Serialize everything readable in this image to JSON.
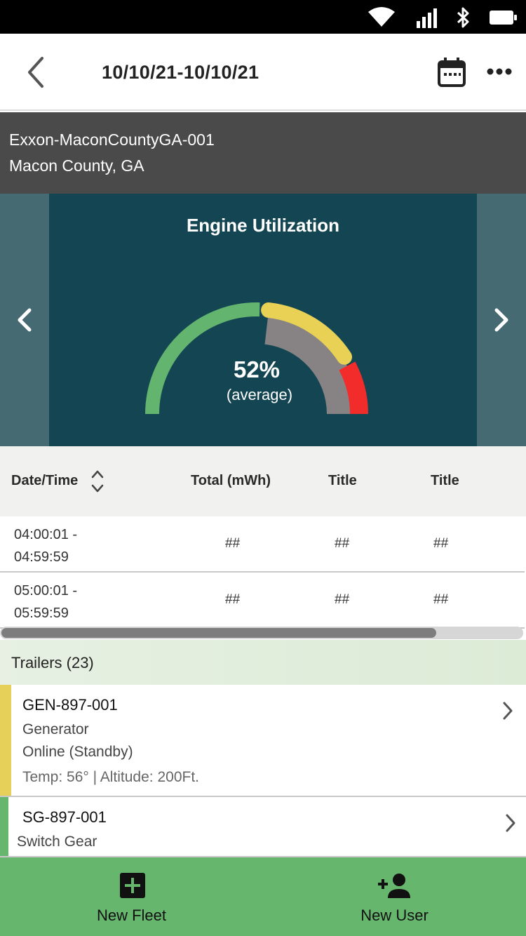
{
  "header": {
    "date_range": "10/10/21-10/10/21"
  },
  "site": {
    "name": "Exxon-MaconCountyGA-001",
    "location": "Macon County, GA"
  },
  "gauge": {
    "title": "Engine Utilization",
    "value_text": "52%",
    "subtitle": "(average)",
    "value_percent": 52,
    "colors": {
      "green": "#63b46f",
      "yellow": "#e8d155",
      "red": "#f22b2b",
      "fill": "#878384"
    }
  },
  "table": {
    "columns": [
      "Date/Time",
      "Total (mWh)",
      "Title",
      "Title"
    ],
    "rows": [
      {
        "time": "04:00:01 - 04:59:59",
        "total": "##",
        "col3": "##",
        "col4": "##"
      },
      {
        "time": "05:00:01 - 05:59:59",
        "total": "##",
        "col3": "##",
        "col4": "##"
      }
    ]
  },
  "trailers": {
    "header": "Trailers (23)",
    "items": [
      {
        "id": "GEN-897-001",
        "type": "Generator",
        "status": "Online (Standby)",
        "meta": "Temp: 56° | Altitude: 200Ft.",
        "accent_color": "#e6d05a"
      },
      {
        "id": "SG-897-001",
        "type": "Switch Gear",
        "accent_color": "#66b66e"
      }
    ]
  },
  "bottom_nav": {
    "new_fleet": "New Fleet",
    "new_user": "New User"
  },
  "colors": {
    "banner": "#4a4a4a",
    "gauge_bg": "#134652",
    "gauge_side": "#466a72",
    "bottom_bar": "#66b66e"
  }
}
